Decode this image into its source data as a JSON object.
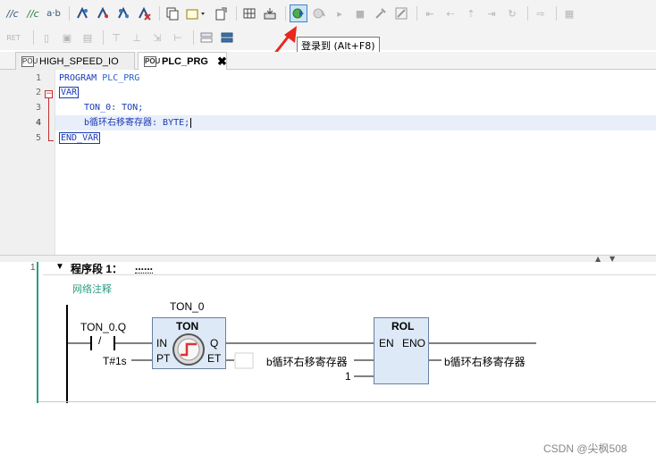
{
  "tooltip": "登录到 (Alt+F8)",
  "tabs": [
    {
      "label": "HIGH_SPEED_IO",
      "icon": "POU"
    },
    {
      "label": "PLC_PRG",
      "icon": "POU",
      "close": "✖"
    }
  ],
  "code": {
    "line_numbers": [
      "1",
      "2",
      "3",
      "4",
      "5"
    ],
    "line1_kw": "PROGRAM",
    "line1_name": "PLC_PRG",
    "line2": "VAR",
    "line3": "TON_0: TON;",
    "line4": "b循环右移寄存器: BYTE;",
    "line5": "END_VAR"
  },
  "toolbar": {
    "row1": [
      "//c",
      "//c",
      "a·b",
      "flag-plus-icon",
      "flag-minus-icon",
      "flag-toggle-icon",
      "flag-clear-icon",
      "copy-icon",
      "insert-dropdown-icon",
      "export-icon",
      "grid-icon",
      "device-icon",
      "login-icon",
      "logout-icon",
      "run-icon",
      "stop-icon",
      "reset-icon",
      "edit-icon",
      "breakpoint-icon",
      "step-over-icon",
      "step-into-icon",
      "step-out-icon",
      "cycle-icon",
      "run-to-cursor-icon",
      "display-icon"
    ],
    "row2_prefix": "RET"
  },
  "network": {
    "number": "1",
    "title": "程序段 1：",
    "title_dots": "......",
    "comment": "网络注释"
  },
  "ladder": {
    "contact_var": "TON_0.Q",
    "contact_symbol": "/",
    "timer_instance": "TON_0",
    "timer_type": "TON",
    "timer_in": "IN",
    "timer_q": "Q",
    "timer_pt": "PT",
    "timer_et": "ET",
    "pt_value": "T#1s",
    "rol_type": "ROL",
    "rol_en": "EN",
    "rol_eno": "ENO",
    "rol_input": "b循环右移寄存器",
    "rol_n": "1",
    "rol_output": "b循环右移寄存器"
  },
  "watermark": "CSDN @尖枫508",
  "colors": {
    "accent": "#2a9d83",
    "keyword": "#1a3ab4",
    "arrow": "#e8261f",
    "fbd_fill": "#dde9f6"
  }
}
